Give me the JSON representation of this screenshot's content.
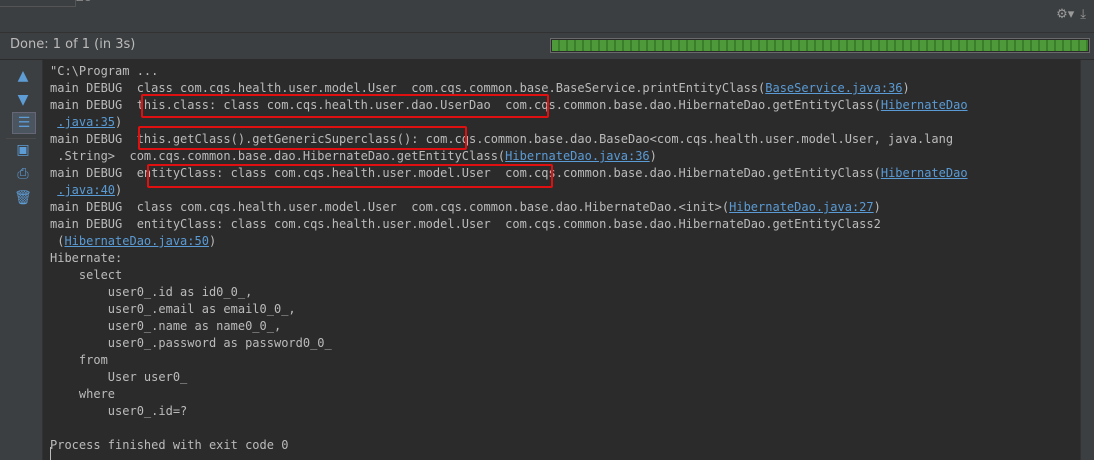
{
  "top": {
    "tab_stub": "ZO"
  },
  "status": {
    "text": "Done: 1 of 1 (in 3s)",
    "progress": 1.0
  },
  "icons": {
    "settings": "gear-icon",
    "pin": "pin-icon",
    "toolbar": [
      "arrow-up-icon",
      "arrow-down-icon",
      "tree-icon",
      "export-icon",
      "print-icon",
      "trash-icon"
    ]
  },
  "console": {
    "lines": [
      {
        "t": "\"C:\\Program ..."
      },
      {
        "t": "main DEBUG  class com.cqs.health.user.model.User  com.cqs.common.base.BaseService.printEntityClass(",
        "link": "BaseService.java:36",
        "after": ")"
      },
      {
        "t": "main DEBUG  this.class: class com.cqs.health.user.dao.UserDao  com.cqs.common.base.dao.HibernateDao.getEntityClass(",
        "link": "HibernateDao"
      },
      {
        "t": " ",
        "link": ".java:35",
        "after": ")"
      },
      {
        "t": "main DEBUG  this.getClass().getGenericSuperclass(): com.cqs.common.base.dao.BaseDao<com.cqs.health.user.model.User, java.lang"
      },
      {
        "t": " .String>  com.cqs.common.base.dao.HibernateDao.getEntityClass(",
        "link": "HibernateDao.java:36",
        "after": ")"
      },
      {
        "t": "main DEBUG  entityClass: class com.cqs.health.user.model.User  com.cqs.common.base.dao.HibernateDao.getEntityClass(",
        "link": "HibernateDao"
      },
      {
        "t": " ",
        "link": ".java:40",
        "after": ")"
      },
      {
        "t": "main DEBUG  class com.cqs.health.user.model.User  com.cqs.common.base.dao.HibernateDao.<init>(",
        "link": "HibernateDao.java:27",
        "after": ")"
      },
      {
        "t": "main DEBUG  entityClass: class com.cqs.health.user.model.User  com.cqs.common.base.dao.HibernateDao.getEntityClass2"
      },
      {
        "t": " (",
        "link": "HibernateDao.java:50",
        "after": ")"
      },
      {
        "t": "Hibernate:"
      },
      {
        "t": "    select"
      },
      {
        "t": "        user0_.id as id0_0_,"
      },
      {
        "t": "        user0_.email as email0_0_,"
      },
      {
        "t": "        user0_.name as name0_0_,"
      },
      {
        "t": "        user0_.password as password0_0_"
      },
      {
        "t": "    from"
      },
      {
        "t": "        User user0_"
      },
      {
        "t": "    where"
      },
      {
        "t": "        user0_.id=?"
      },
      {
        "t": ""
      },
      {
        "t": "Process finished with exit code 0"
      }
    ]
  },
  "highlights": [
    "this.class: class com.cqs.health.user.dao.UserDao",
    "this.getClass().getGenericSuperclass():",
    "entityClass: class com.cqs.health.user.model.User"
  ]
}
